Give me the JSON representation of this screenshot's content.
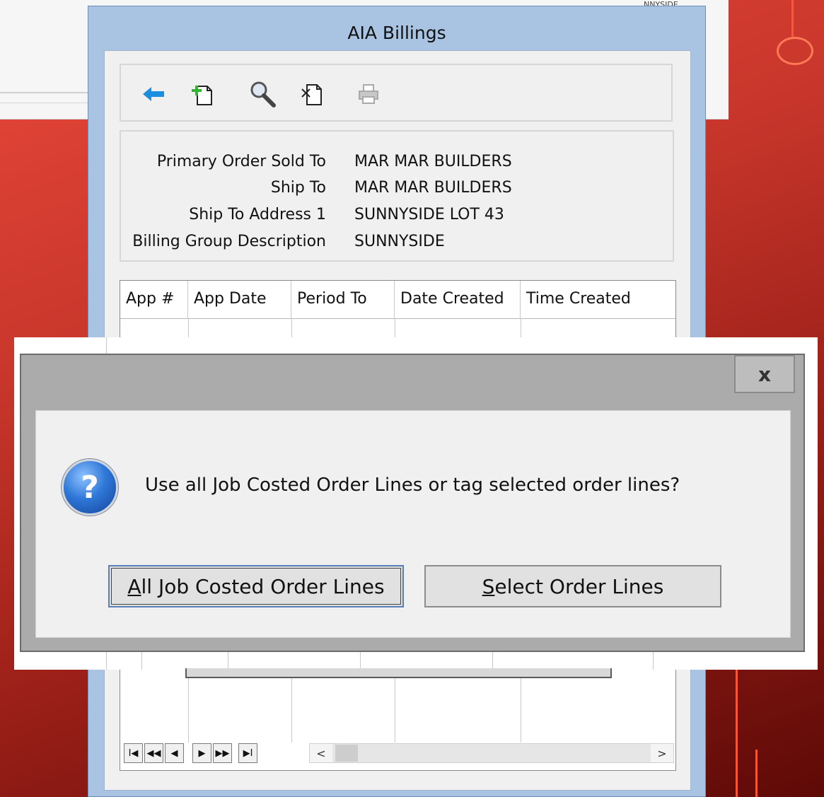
{
  "window": {
    "title": "AIA Billings"
  },
  "toolbar": {
    "icons": [
      "back-arrow-icon",
      "new-document-icon",
      "search-icon",
      "delete-document-icon",
      "print-icon"
    ]
  },
  "info": {
    "rows": [
      {
        "label": "Primary Order Sold To",
        "value": "MAR MAR BUILDERS"
      },
      {
        "label": "Ship To",
        "value": "MAR MAR BUILDERS"
      },
      {
        "label": "Ship To Address 1",
        "value": "SUNNYSIDE LOT 43"
      },
      {
        "label": "Billing Group Description",
        "value": "SUNNYSIDE"
      }
    ]
  },
  "grid": {
    "columns": [
      "App #",
      "App Date",
      "Period To",
      "Date Created",
      "Time Created"
    ],
    "nav": [
      "I◀",
      "◀◀",
      "◀",
      "▶",
      "▶▶",
      "▶I"
    ],
    "scroll_left": "<",
    "scroll_right": ">"
  },
  "dialog": {
    "close": "x",
    "icon": "?",
    "message": "Use all Job Costed Order Lines or tag selected order lines?",
    "button_all": {
      "accel": "A",
      "rest": "ll Job Costed Order Lines"
    },
    "button_select": {
      "accel": "S",
      "rest": "elect Order Lines"
    }
  },
  "background": {
    "snippet": "NNYSIDE"
  },
  "colors": {
    "title_bar": "#a9c4e2",
    "dialog_frame": "#ababab",
    "accent_blue": "#1a8fe0",
    "slide_red": "#c8362b"
  }
}
